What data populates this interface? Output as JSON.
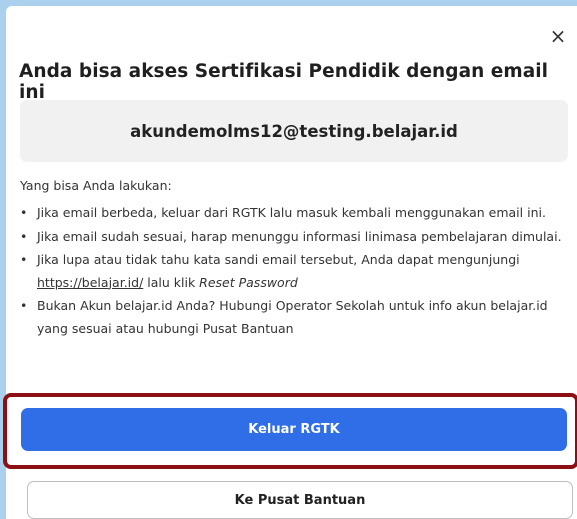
{
  "dialog": {
    "close_icon": "×",
    "title": "Anda bisa akses Sertifikasi Pendidik dengan email ini",
    "email": "akundemolms12@testing.belajar.id",
    "subtitle": "Yang bisa Anda lakukan:",
    "bullets": [
      {
        "text": "Jika email berbeda, keluar dari RGTK lalu masuk kembali menggunakan email ini."
      },
      {
        "text": "Jika email sudah sesuai, harap menunggu informasi linimasa pembelajaran dimulai."
      },
      {
        "text_before": "Jika lupa atau tidak tahu kata sandi email tersebut, Anda dapat mengunjungi ",
        "link": "https://belajar.id/",
        "text_middle": " lalu klik ",
        "italic": "Reset Password"
      },
      {
        "text": "Bukan Akun belajar.id Anda? Hubungi Operator Sekolah untuk info akun belajar.id yang sesuai atau hubungi Pusat Bantuan"
      }
    ],
    "primary_button": "Keluar RGTK",
    "secondary_button": "Ke Pusat Bantuan"
  },
  "colors": {
    "backdrop": "#aad0ee",
    "primary": "#2f6ee6",
    "highlight": "#8b0f13"
  }
}
